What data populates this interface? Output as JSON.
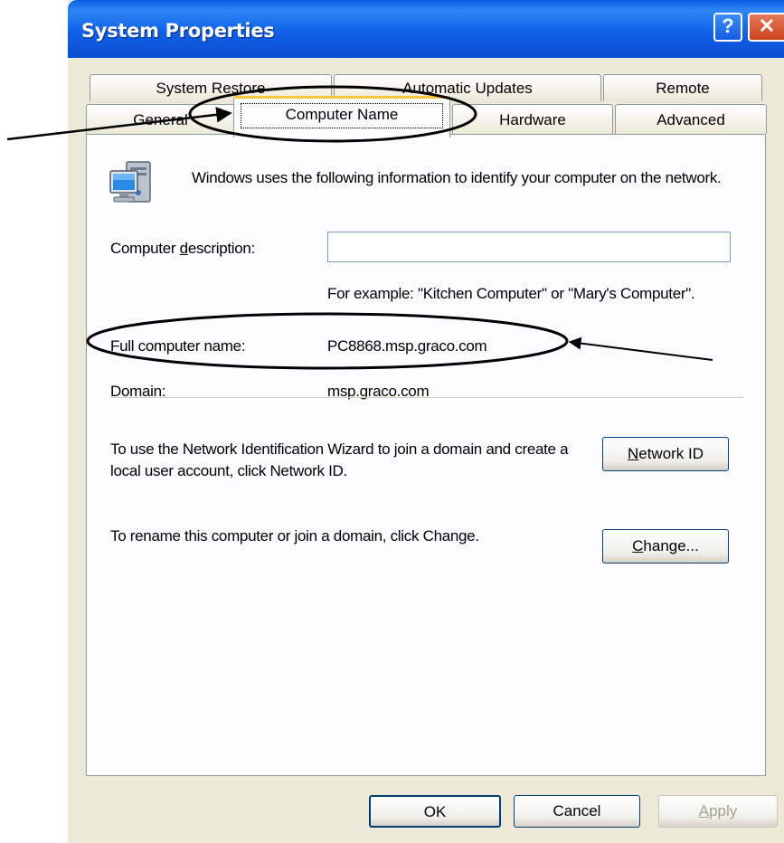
{
  "window": {
    "title": "System Properties"
  },
  "titlebar": {
    "help_label": "?",
    "close_label": "✕"
  },
  "tabs": {
    "row1": [
      "System Restore",
      "Automatic Updates",
      "Remote"
    ],
    "row2": [
      "General",
      "Computer Name",
      "Hardware",
      "Advanced"
    ],
    "active": "Computer Name"
  },
  "panel": {
    "icon": "computer-network-icon",
    "intro": "Windows uses the following information to identify your computer on the network.",
    "description_label": {
      "before": "Computer ",
      "key": "d",
      "after": "escription:"
    },
    "description_value": "",
    "example_text": "For example: \"Kitchen Computer\" or \"Mary's Computer\".",
    "full_name_label": "Full computer name:",
    "full_name_value": "PC8868.msp.graco.com",
    "domain_label": "Domain:",
    "domain_value": "msp.graco.com",
    "wizard_text": "To use the Network Identification Wizard to join a domain and create a local user account, click Network ID.",
    "network_id_button": {
      "key": "N",
      "rest": "etwork ID"
    },
    "rename_text": "To rename this computer or join a domain, click Change.",
    "change_button": {
      "key": "C",
      "rest": "hange..."
    }
  },
  "footer": {
    "ok": "OK",
    "cancel": "Cancel",
    "apply": {
      "key": "A",
      "rest": "pply"
    }
  },
  "colors": {
    "titlebar": "#0a5fe0",
    "dialog_bg": "#ece9d8",
    "active_tab_accent": "#ffc83c",
    "annotation": "#000000"
  }
}
